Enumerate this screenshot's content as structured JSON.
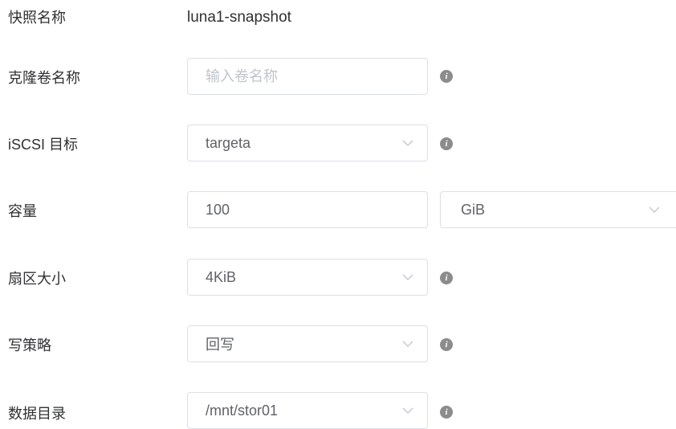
{
  "snapshot": {
    "label": "快照名称",
    "value": "luna1-snapshot"
  },
  "clone_name": {
    "label": "克隆卷名称",
    "placeholder": "输入卷名称",
    "value": ""
  },
  "iscsi_target": {
    "label": "iSCSI 目标",
    "value": "targeta"
  },
  "capacity": {
    "label": "容量",
    "value": "100",
    "unit": "GiB"
  },
  "sector_size": {
    "label": "扇区大小",
    "value": "4KiB"
  },
  "write_policy": {
    "label": "写策略",
    "value": "回写"
  },
  "data_dir": {
    "label": "数据目录",
    "value": "/mnt/stor01"
  },
  "icons": {
    "info": "info-icon",
    "chevron": "chevron-down-icon"
  },
  "colors": {
    "border": "#dcdfe6",
    "label_text": "#303133",
    "value_text": "#606266",
    "placeholder": "#c0c4cc",
    "info_icon": "#8c8c8c"
  }
}
